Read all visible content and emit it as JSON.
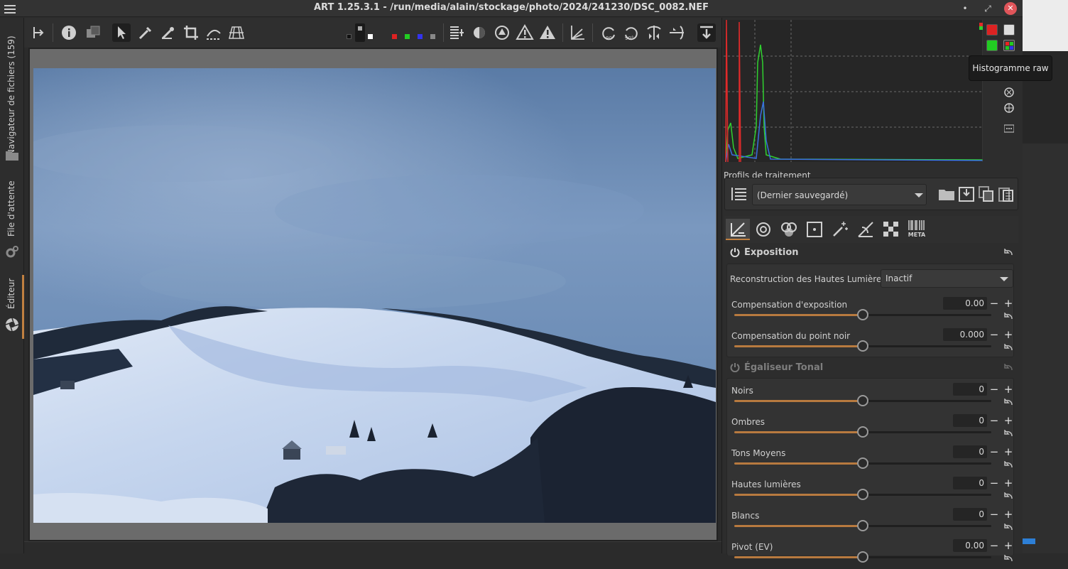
{
  "window": {
    "title": "ART 1.25.3.1 - /run/media/alain/stockage/photo/2024/241230/DSC_0082.NEF",
    "btn_minimize": "•",
    "btn_maximize": "⤢",
    "btn_close": "✕"
  },
  "left_tabs": {
    "file_browser": "Navigateur de fichiers (159)",
    "queue": "File d'attente",
    "editor": "Éditeur"
  },
  "tooltip": "Histogramme raw",
  "profiles": {
    "label": "Profils de traitement",
    "selected": "(Dernier sauvegardé)"
  },
  "tool_tabs": {
    "meta_label": "META"
  },
  "exposure": {
    "title": "Exposition",
    "hl_recon_label": "Reconstruction des Hautes Lumières:",
    "hl_recon_value": "Inactif",
    "sliders": [
      {
        "label": "Compensation d'exposition",
        "value": "0.00",
        "position": 0.5
      },
      {
        "label": "Compensation du point noir",
        "value": "0.000",
        "position": 0.5
      }
    ]
  },
  "tone_eq": {
    "title": "Égaliseur Tonal",
    "sliders": [
      {
        "label": "Noirs",
        "value": "0",
        "position": 0.5
      },
      {
        "label": "Ombres",
        "value": "0",
        "position": 0.5
      },
      {
        "label": "Tons Moyens",
        "value": "0",
        "position": 0.5
      },
      {
        "label": "Hautes lumières",
        "value": "0",
        "position": 0.5
      },
      {
        "label": "Blancs",
        "value": "0",
        "position": 0.5
      },
      {
        "label": "Pivot (EV)",
        "value": "0.00",
        "position": 0.5
      }
    ]
  },
  "colors": {
    "accent": "#c08040",
    "slider_fill": "#b87a3f",
    "histo_green": "#2fd12f",
    "histo_blue": "#3a6fe0",
    "histo_red": "#e02a2a"
  }
}
